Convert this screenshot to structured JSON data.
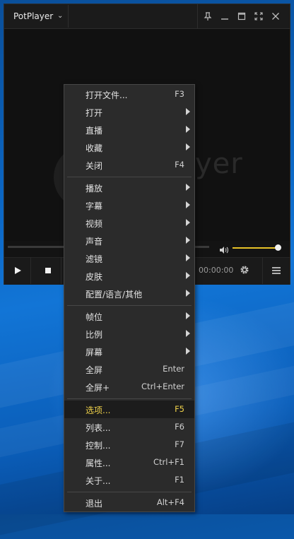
{
  "app": {
    "title": "PotPlayer",
    "watermark": "yer"
  },
  "playback": {
    "time": "00:00:00",
    "volume_percent": 100
  },
  "menu": {
    "items": [
      {
        "label": "打开文件...",
        "shortcut": "F3"
      },
      {
        "label": "打开",
        "shortcut": ""
      },
      {
        "label": "直播",
        "shortcut": ""
      },
      {
        "label": "收藏",
        "shortcut": ""
      },
      {
        "label": "关闭",
        "shortcut": "F4"
      },
      {
        "label": "播放",
        "shortcut": ""
      },
      {
        "label": "字幕",
        "shortcut": ""
      },
      {
        "label": "视频",
        "shortcut": ""
      },
      {
        "label": "声音",
        "shortcut": ""
      },
      {
        "label": "滤镜",
        "shortcut": ""
      },
      {
        "label": "皮肤",
        "shortcut": ""
      },
      {
        "label": "配置/语言/其他",
        "shortcut": ""
      },
      {
        "label": "帧位",
        "shortcut": ""
      },
      {
        "label": "比例",
        "shortcut": ""
      },
      {
        "label": "屏幕",
        "shortcut": ""
      },
      {
        "label": "全屏",
        "shortcut": "Enter"
      },
      {
        "label": "全屏+",
        "shortcut": "Ctrl+Enter"
      },
      {
        "label": "选项...",
        "shortcut": "F5"
      },
      {
        "label": "列表...",
        "shortcut": "F6"
      },
      {
        "label": "控制...",
        "shortcut": "F7"
      },
      {
        "label": "属性...",
        "shortcut": "Ctrl+F1"
      },
      {
        "label": "关于...",
        "shortcut": "F1"
      },
      {
        "label": "退出",
        "shortcut": "Alt+F4"
      }
    ]
  },
  "colors": {
    "highlight_text": "#f0d24a",
    "volume_accent": "#e7c227"
  }
}
